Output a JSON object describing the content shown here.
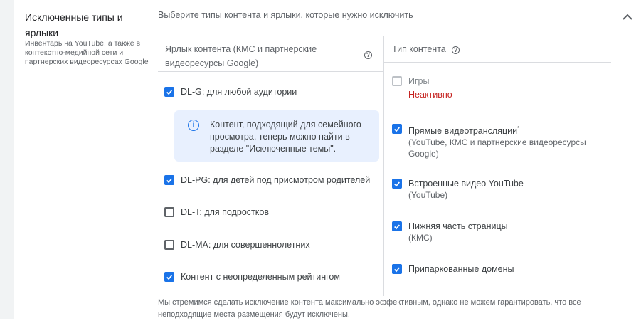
{
  "section": {
    "title": "Исключенные типы и ярлыки",
    "description": "Инвентарь на YouTube, а также в контекстно-медийной сети и партнерских видеоресурсах Google",
    "intro": "Выберите типы контента и ярлыки, которые нужно исключить",
    "collapse_icon": "chevron-up-icon"
  },
  "labels_column": {
    "header": "Ярлык контента (КМС и партнерские видеоресурсы Google)",
    "items": [
      {
        "label": "DL-G: для любой аудитории",
        "checked": true
      },
      {
        "label": "DL-PG: для детей под присмотром родителей",
        "checked": true
      },
      {
        "label": "DL-T: для подростков",
        "checked": false
      },
      {
        "label": "DL-MA: для совершеннолетних",
        "checked": false
      },
      {
        "label": "Контент с неопределенным рейтингом",
        "checked": true
      }
    ],
    "info": "Контент, подходящий для семейного просмотра, теперь можно найти в разделе \"Исключенные темы\"."
  },
  "types_column": {
    "header": "Тип контента",
    "items": [
      {
        "label": "Игры",
        "status": "Неактивно",
        "checked": false
      },
      {
        "label": "Прямые видеотрансляции",
        "sup": "*",
        "sub": "(YouTube, КМС и партнерские видеоресурсы Google)",
        "checked": true
      },
      {
        "label": "Встроенные видео YouTube",
        "sub": "(YouTube)",
        "checked": true
      },
      {
        "label": "Нижняя часть страницы",
        "sub": "(КМС)",
        "checked": true
      },
      {
        "label": "Припаркованные домены",
        "checked": true
      }
    ]
  },
  "footer": "Мы стремимся сделать исключение контента максимально эффективным, однако не можем гарантировать, что все неподходящие места размещения будут исключены.",
  "help_glyph": "?",
  "info_glyph": "i"
}
